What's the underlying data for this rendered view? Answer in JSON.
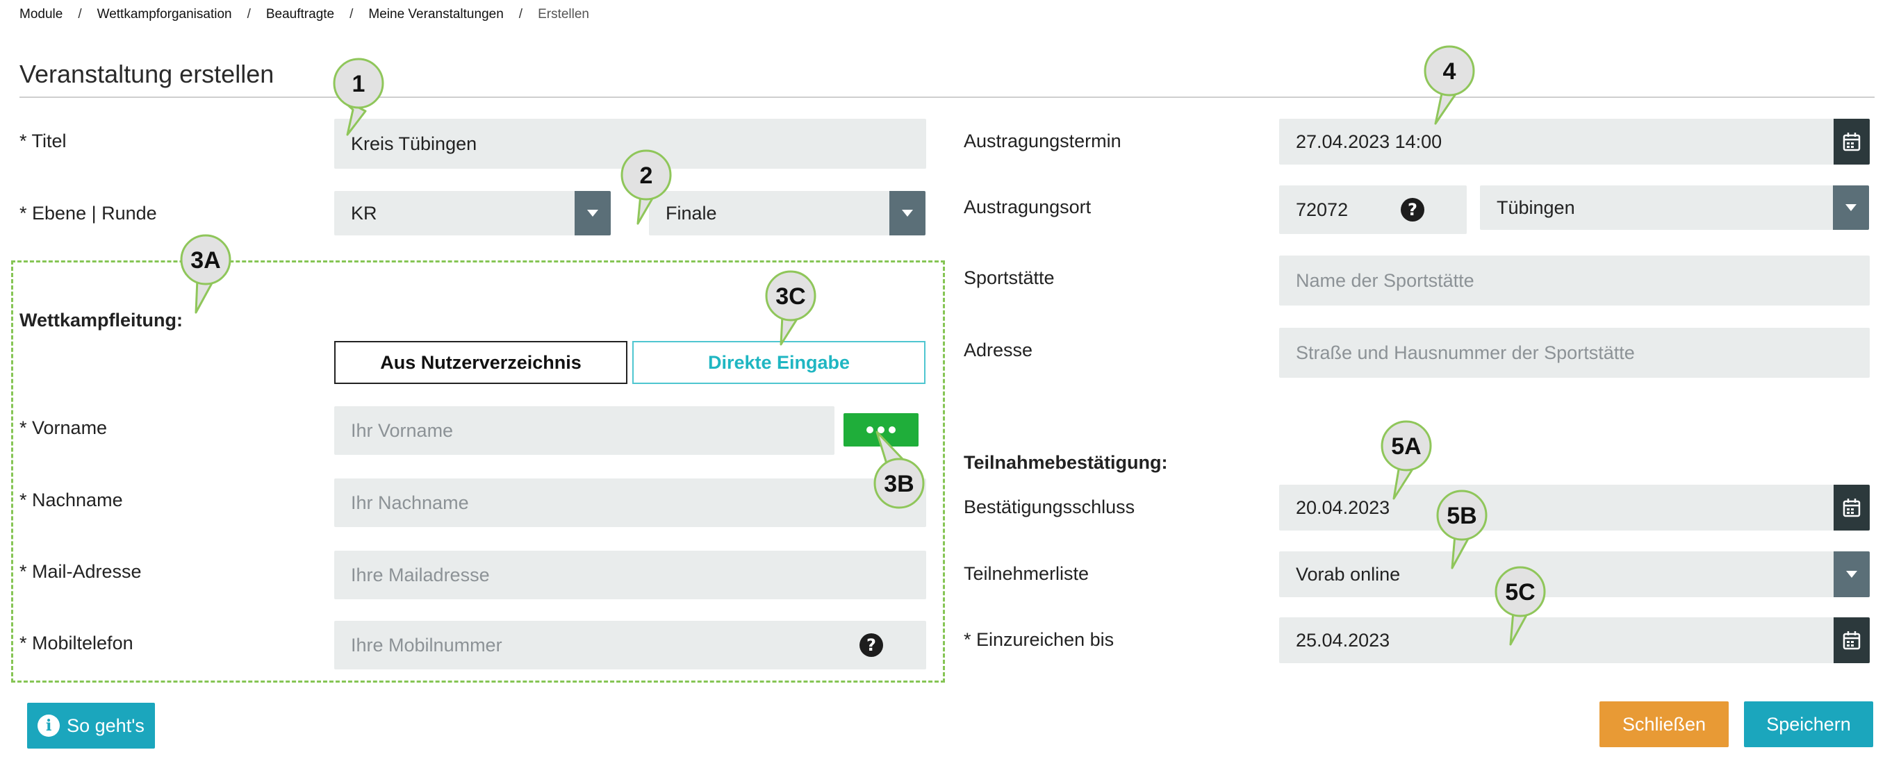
{
  "breadcrumb": {
    "items": [
      "Module",
      "Wettkampforganisation",
      "Beauftragte",
      "Meine Veranstaltungen"
    ],
    "current": "Erstellen",
    "separator": "/"
  },
  "page": {
    "title": "Veranstaltung erstellen"
  },
  "left": {
    "titel": {
      "label": "* Titel",
      "value": "Kreis Tübingen"
    },
    "ebene": {
      "label": "* Ebene | Runde",
      "ebene_value": "KR",
      "runde_value": "Finale"
    },
    "wettkampfleitung": {
      "heading": "Wettkampfleitung:",
      "toggle_left": "Aus Nutzerverzeichnis",
      "toggle_right": "Direkte Eingabe",
      "vorname": {
        "label": "* Vorname",
        "placeholder": "Ihr Vorname"
      },
      "nachname": {
        "label": "* Nachname",
        "placeholder": "Ihr Nachname"
      },
      "mail": {
        "label": "* Mail-Adresse",
        "placeholder": "Ihre Mailadresse"
      },
      "mobil": {
        "label": "* Mobiltelefon",
        "placeholder": "Ihre Mobilnummer"
      }
    }
  },
  "right": {
    "termin": {
      "label": "Austragungstermin",
      "value": "27.04.2023 14:00"
    },
    "ort": {
      "label": "Austragungsort",
      "plz": "72072",
      "city": "Tübingen"
    },
    "sportstaette": {
      "label": "Sportstätte",
      "placeholder": "Name der Sportstätte"
    },
    "adresse": {
      "label": "Adresse",
      "placeholder": "Straße und Hausnummer der Sportstätte"
    },
    "teilnahme": {
      "heading": "Teilnahmebestätigung:",
      "schluss": {
        "label": "Bestätigungsschluss",
        "value": "20.04.2023"
      },
      "liste": {
        "label": "Teilnehmerliste",
        "value": "Vorab online"
      },
      "einreichen": {
        "label": "* Einzureichen bis",
        "value": "25.04.2023"
      }
    }
  },
  "buttons": {
    "help": "So geht's",
    "close": "Schließen",
    "save": "Speichern"
  },
  "callouts": {
    "c1": "1",
    "c2": "2",
    "c3a": "3A",
    "c3b": "3B",
    "c3c": "3C",
    "c4": "4",
    "c5a": "5A",
    "c5b": "5B",
    "c5c": "5C"
  },
  "icons": {
    "help": "question-circle-icon",
    "calendar": "calendar-icon",
    "dropdown": "chevron-down-icon",
    "more": "more-dots-icon",
    "info": "info-icon"
  },
  "colors": {
    "accent_teal": "#1ba6bd",
    "close_orange": "#e89a35",
    "dots_green": "#1fae3a",
    "dashed_green": "#86c555",
    "field_bg": "#e9ecec",
    "dropdown_grey": "#5b6f78",
    "calendar_dark": "#2c393c"
  }
}
